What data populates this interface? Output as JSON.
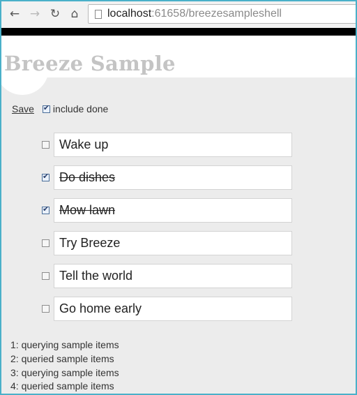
{
  "browser": {
    "url_host": "localhost",
    "url_path": ":61658/breezesampleshell"
  },
  "header": {
    "title": "Breeze Sample"
  },
  "toolbar": {
    "save_label": "Save",
    "include_done_label": "include done",
    "include_done_checked": true
  },
  "todos": [
    {
      "text": "Wake up",
      "done": false
    },
    {
      "text": "Do dishes",
      "done": true
    },
    {
      "text": "Mow lawn",
      "done": true
    },
    {
      "text": "Try Breeze",
      "done": false
    },
    {
      "text": "Tell the world",
      "done": false
    },
    {
      "text": "Go home early",
      "done": false
    }
  ],
  "log": [
    "1: querying sample items",
    "2: queried sample items",
    "3: querying sample items",
    "4: queried sample items"
  ]
}
